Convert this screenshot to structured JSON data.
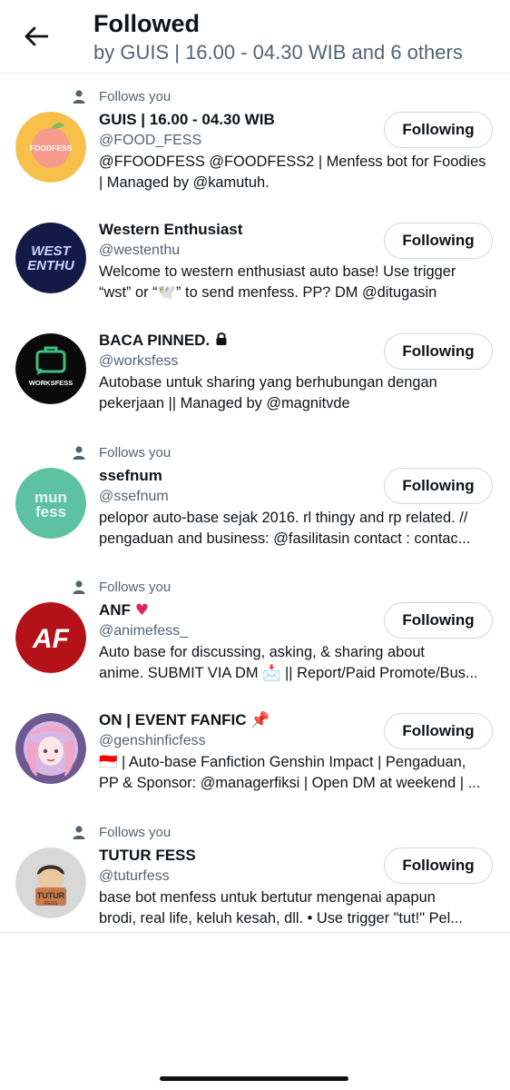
{
  "header": {
    "title": "Followed",
    "subtitle": "by GUIS | 16.00 - 04.30 WIB and 6 others"
  },
  "follows_you_label": "Follows you",
  "users": [
    {
      "name": "GUIS | 16.00 - 04.30 WIB",
      "handle": "@FOOD_FESS",
      "bio": [
        "@FFOODFESS @FOODFESS2 | Menfess bot for Foodies",
        "| Managed by @kamutuh."
      ],
      "follows_you": true,
      "button_label": "Following",
      "avatar_text": "FOODFESS"
    },
    {
      "name": "Western Enthusiast",
      "handle": "@westenthu",
      "bio": [
        "Welcome to western enthusiast auto base! Use trigger",
        "“wst” or “🕊️” to send menfess. PP? DM @ditugasin"
      ],
      "follows_you": false,
      "button_label": "Following",
      "avatar_text": [
        "WEST",
        "ENTHU"
      ]
    },
    {
      "name": "BACA PINNED.",
      "handle": "@worksfess",
      "bio": [
        "Autobase untuk sharing yang berhubungan dengan",
        "pekerjaan || Managed by @magnitvde"
      ],
      "follows_you": false,
      "button_label": "Following",
      "avatar_text": "WORKSFESS"
    },
    {
      "name": "ssefnum",
      "handle": "@ssefnum",
      "bio": [
        "pelopor auto-base sejak 2016. rl thingy and rp related. //",
        "pengaduan and business: @fasilitasin contact : contac..."
      ],
      "follows_you": true,
      "button_label": "Following",
      "avatar_text": [
        "mun",
        "fess"
      ]
    },
    {
      "name": "ANF",
      "name_emoji": "♥",
      "handle": "@animefess_",
      "bio": [
        "Auto base for discussing, asking, & sharing about",
        "anime. SUBMIT VIA DM 📩 || Report/Paid Promote/Bus..."
      ],
      "follows_you": true,
      "button_label": "Following",
      "avatar_text": "AF"
    },
    {
      "name": "ON | EVENT FANFIC",
      "name_emoji": "📌",
      "handle": "@genshinficfess",
      "bio": [
        "🇮🇩 | Auto-base Fanfiction Genshin Impact | Pengaduan,",
        "PP & Sponsor: @managerfiksi | Open DM at weekend | ..."
      ],
      "follows_you": false,
      "button_label": "Following"
    },
    {
      "name": "TUTUR FESS",
      "handle": "@tuturfess",
      "bio": [
        "base bot menfess untuk bertutur mengenai apapun",
        "brodi, real life, keluh kesah, dll. • Use trigger \"tut!\" Pel..."
      ],
      "follows_you": true,
      "button_label": "Following",
      "avatar_text": [
        "TUTUR",
        "FESS"
      ]
    }
  ],
  "colors": {
    "text": "#0f1419",
    "secondary": "#536471",
    "border": "#cfd9de",
    "divider": "#e6e9ec"
  },
  "icons": {
    "back": "arrow-left-icon",
    "follows_you": "person-icon",
    "protected": "lock-icon"
  }
}
